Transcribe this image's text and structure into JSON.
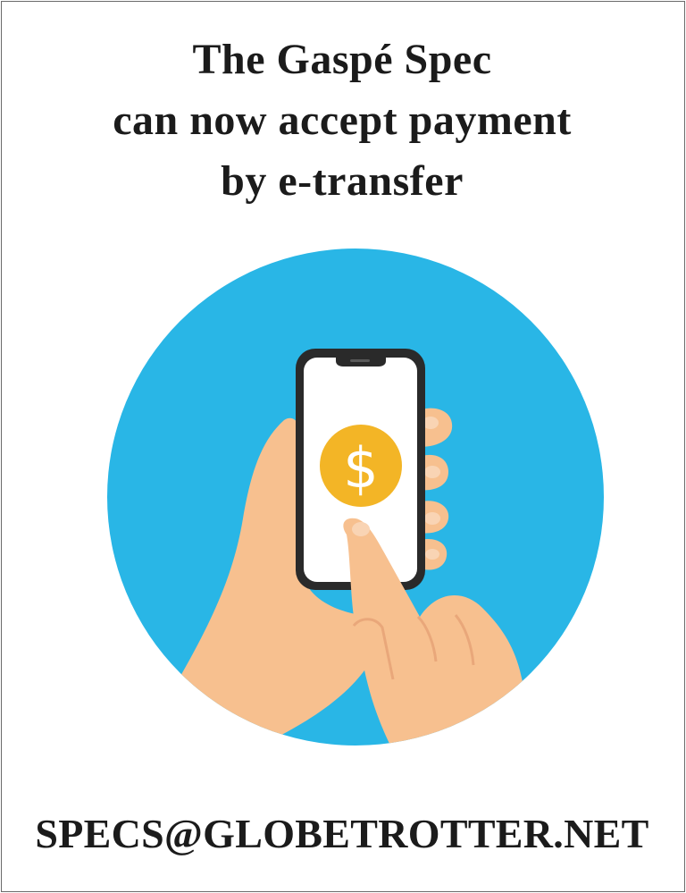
{
  "ad": {
    "headline_lines": [
      "The Gaspé Spec",
      "can now accept payment",
      "by e-transfer"
    ],
    "email": "SPECS@GLOBETROTTER.NET"
  },
  "illustration": {
    "icons": [
      "phone-icon",
      "dollar-coin-icon",
      "holding-hand-icon",
      "pointing-hand-icon"
    ],
    "colors": {
      "circle": "#29b6e6",
      "phone_frame": "#2a2a2a",
      "screen": "#ffffff",
      "coin": "#f3b526",
      "skin": "#f7c08f",
      "skin_shadow": "#e9a77a"
    }
  }
}
